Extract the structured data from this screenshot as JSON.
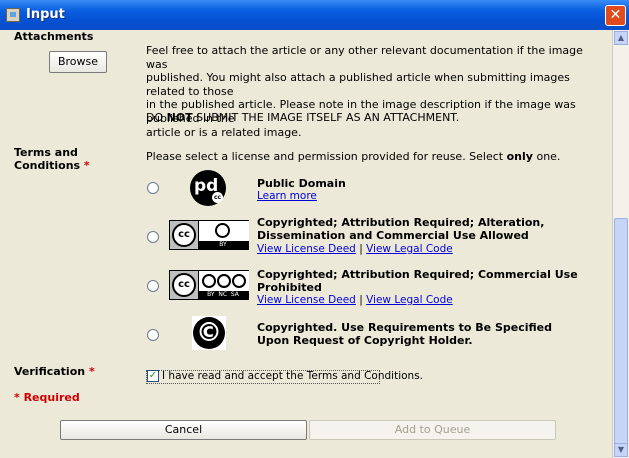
{
  "window": {
    "title": "Input",
    "close_symbol": "✕"
  },
  "attachments": {
    "label": "Attachments",
    "browse_label": "Browse",
    "description_lines": [
      "Feel free to attach the article or any other relevant documentation if the image was",
      "published. You might also attach a published article when submitting images related to those",
      "in the published article. Please note in the image description if the image was published in the",
      "article or is a related image."
    ],
    "warning_prefix": "DO ",
    "warning_emphasis": "NOT",
    "warning_suffix": " SUBMIT THE IMAGE ITSELF AS AN ATTACHMENT."
  },
  "terms": {
    "label_line1": "Terms and",
    "label_line2": "Conditions",
    "required_mark": "*",
    "instruction_prefix": "Please select a license and permission provided for reuse. Select ",
    "instruction_emphasis": "only",
    "instruction_suffix": " one."
  },
  "licenses": [
    {
      "title_lines": [
        "Public Domain"
      ],
      "links": [
        "Learn more"
      ],
      "badge_text": "pd",
      "badge_sub": "cc"
    },
    {
      "title_lines": [
        "Copyrighted; Attribution Required; Alteration,",
        "Dissemination and Commercial Use Allowed"
      ],
      "links": [
        "View License Deed",
        "View Legal Code"
      ],
      "link_separator": "|",
      "badge_text": "cc",
      "badge_sub": "BY"
    },
    {
      "title_lines": [
        "Copyrighted; Attribution Required; Commercial Use",
        "Prohibited"
      ],
      "links": [
        "View License Deed",
        "View Legal Code"
      ],
      "link_separator": "|",
      "badge_text": "cc",
      "badge_sub": "BY  NC  SA"
    },
    {
      "title_lines": [
        "Copyrighted. Use Requirements to Be Specified",
        "Upon Request of Copyright Holder."
      ],
      "links": [],
      "badge_text": "©"
    }
  ],
  "verification": {
    "label": "Verification",
    "required_mark": "*",
    "checkbox_label": "I have read and accept the Terms and Conditions.",
    "checked": true,
    "check_symbol": "✓"
  },
  "required_note": "* Required",
  "buttons": {
    "cancel": "Cancel",
    "add_to_queue": "Add to Queue"
  },
  "colors": {
    "titlebar": "#0a5fe0",
    "required": "#d10000",
    "link": "#0000dd",
    "background": "#ece9d8"
  }
}
